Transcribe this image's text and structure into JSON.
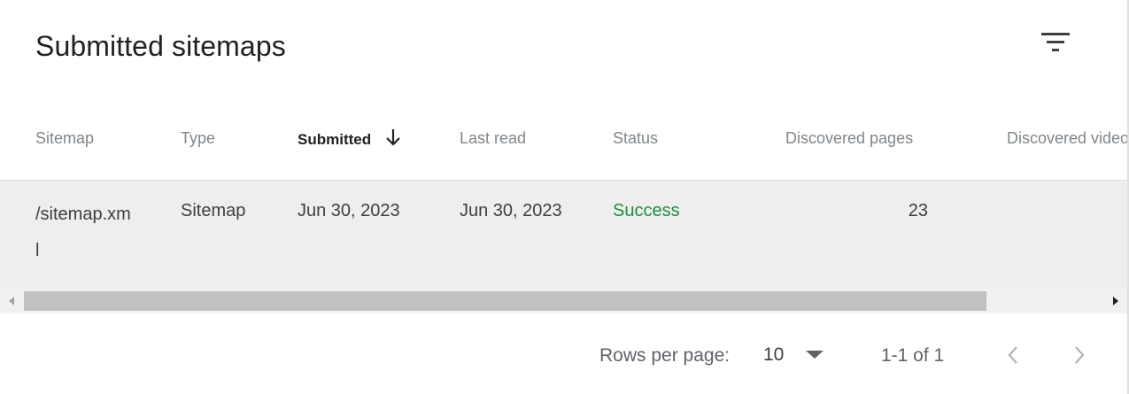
{
  "title": "Submitted sitemaps",
  "filter": {
    "icon": "filter-icon"
  },
  "table": {
    "columns": [
      {
        "label": "Sitemap"
      },
      {
        "label": "Type"
      },
      {
        "label": "Submitted",
        "sort": "descending"
      },
      {
        "label": "Last read"
      },
      {
        "label": "Status"
      },
      {
        "label": "Discovered pages"
      },
      {
        "label": "Discovered videos"
      }
    ],
    "rows": [
      {
        "sitemap": "/sitemap.xml",
        "type": "Sitemap",
        "submitted": "Jun 30, 2023",
        "last_read": "Jun 30, 2023",
        "status": "Success",
        "discovered_pages": "23",
        "discovered_videos": ""
      }
    ]
  },
  "pagination": {
    "rows_per_page_label": "Rows per page:",
    "rows_per_page_value": "10",
    "range": "1-1 of 1"
  },
  "colors": {
    "status_success": "#1e8e3e",
    "row_highlight": "#eeeeee",
    "header_text": "#80868b"
  }
}
